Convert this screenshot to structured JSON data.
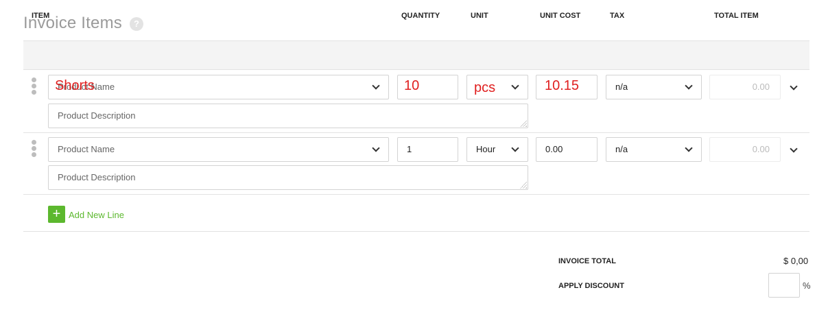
{
  "section": {
    "title": "Invoice Items",
    "help": "?"
  },
  "headers": {
    "item": "ITEM",
    "quantity": "QUANTITY",
    "unit": "UNIT",
    "unit_cost": "UNIT COST",
    "tax": "TAX",
    "total": "TOTAL ITEM"
  },
  "rows": [
    {
      "product_placeholder": "Product Name",
      "description_placeholder": "Product Description",
      "quantity": "",
      "unit": "",
      "unit_cost": "",
      "tax": "n/a",
      "total": "0.00",
      "overlay": {
        "product": "Shorts",
        "quantity": "10",
        "unit": "pcs",
        "unit_cost": "10.15"
      }
    },
    {
      "product_placeholder": "Product Name",
      "description_placeholder": "Product Description",
      "quantity": "1",
      "unit": "Hour",
      "unit_cost": "0.00",
      "tax": "n/a",
      "total": "0.00"
    }
  ],
  "add_line": {
    "icon": "+",
    "label": "Add New Line"
  },
  "summary": {
    "total_label": "INVOICE TOTAL",
    "total_value": "$ 0,00",
    "discount_label": "APPLY DISCOUNT",
    "discount_unit": "%"
  },
  "colors": {
    "accent": "#5cb82e",
    "overlay_text": "#e02020"
  }
}
